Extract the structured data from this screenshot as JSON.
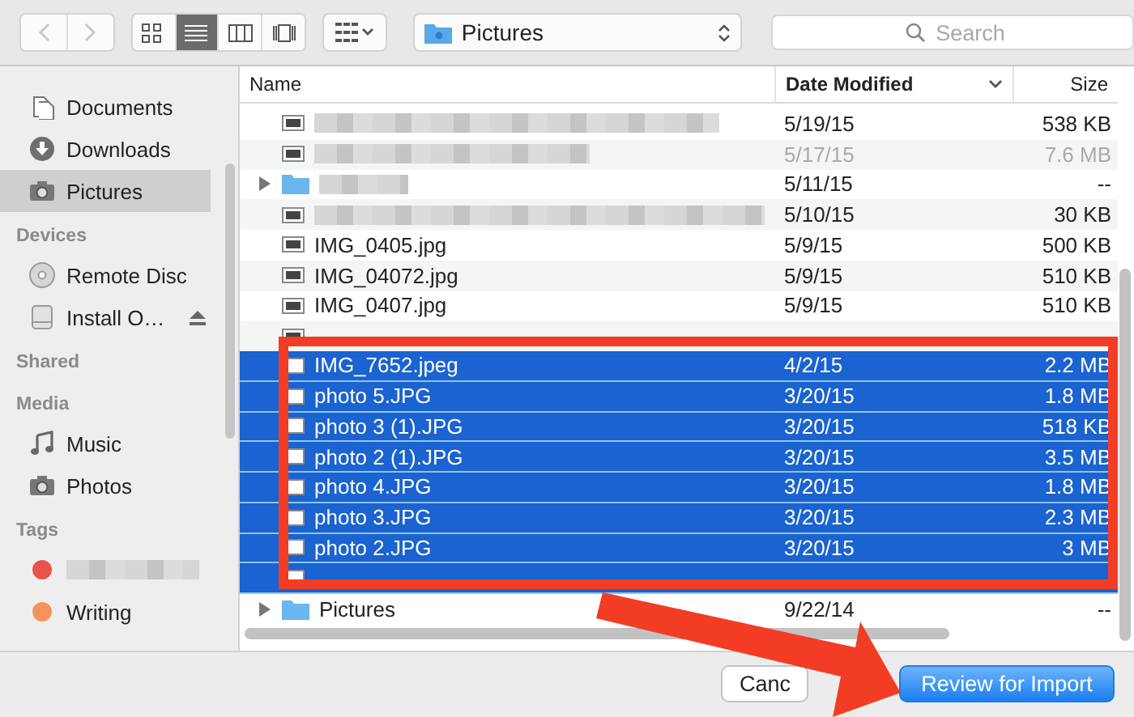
{
  "toolbar": {
    "view_modes": [
      {
        "kind": "icons",
        "selected": false
      },
      {
        "kind": "list",
        "selected": true
      },
      {
        "kind": "columns",
        "selected": false
      },
      {
        "kind": "coverflow",
        "selected": false
      }
    ],
    "location": "Pictures",
    "search": {
      "placeholder": "Search"
    }
  },
  "sidebar": [
    {
      "items": [
        {
          "label": "Documents",
          "kind": "documents",
          "selected": false
        },
        {
          "label": "Downloads",
          "kind": "downloads",
          "selected": false
        },
        {
          "label": "Pictures",
          "kind": "camera",
          "selected": true
        }
      ]
    },
    {
      "title": "Devices",
      "items": [
        {
          "label": "Remote Disc",
          "kind": "disc",
          "selected": false,
          "eject": false
        },
        {
          "label": "Install O…",
          "kind": "disk",
          "selected": false,
          "eject": true
        }
      ]
    },
    {
      "title": "Shared"
    },
    {
      "title": "Media",
      "items": [
        {
          "label": "Music",
          "kind": "music",
          "selected": false
        },
        {
          "label": "Photos",
          "kind": "camera",
          "selected": false
        }
      ]
    },
    {
      "title": "Tags",
      "items": [
        {
          "kind": "tag",
          "redacted": true,
          "color": "#e8534a",
          "selected": false
        },
        {
          "kind": "tag",
          "label": "Writing",
          "color": "#f5935a",
          "selected": false
        }
      ]
    }
  ],
  "table": {
    "columns": [
      {
        "label": "Name",
        "sorted": false
      },
      {
        "label": "Date Modified",
        "sorted": true
      },
      {
        "label": "Size",
        "sorted": false
      }
    ],
    "rows": [
      {
        "kind": "file",
        "redacted": true,
        "date": "5/19/15",
        "size": "538 KB",
        "selected": false,
        "dimmed": false
      },
      {
        "kind": "file",
        "redacted": true,
        "date": "5/17/15",
        "size": "7.6 MB",
        "selected": false,
        "dimmed": true
      },
      {
        "kind": "folder",
        "redacted": true,
        "date": "5/11/15",
        "size": "--",
        "selected": false,
        "dimmed": false
      },
      {
        "kind": "file",
        "redacted": true,
        "date": "5/10/15",
        "size": "30 KB",
        "selected": false,
        "dimmed": false
      },
      {
        "kind": "file",
        "name": "IMG_0405.jpg",
        "date": "5/9/15",
        "size": "500 KB",
        "selected": false,
        "dimmed": false
      },
      {
        "kind": "file",
        "name": "IMG_04072.jpg",
        "date": "5/9/15",
        "size": "510 KB",
        "selected": false,
        "dimmed": false
      },
      {
        "kind": "file",
        "name": "IMG_0407.jpg",
        "date": "5/9/15",
        "size": "510 KB",
        "selected": false,
        "dimmed": false
      },
      {
        "kind": "file",
        "selected": false
      },
      {
        "kind": "file",
        "name": "IMG_7652.jpeg",
        "date": "4/2/15",
        "size": "2.2 MB",
        "selected": true,
        "dimmed": false
      },
      {
        "kind": "file",
        "name": "photo 5.JPG",
        "date": "3/20/15",
        "size": "1.8 MB",
        "selected": true,
        "dimmed": false
      },
      {
        "kind": "file",
        "name": "photo 3 (1).JPG",
        "date": "3/20/15",
        "size": "518 KB",
        "selected": true,
        "dimmed": false
      },
      {
        "kind": "file",
        "name": "photo 2 (1).JPG",
        "date": "3/20/15",
        "size": "3.5 MB",
        "selected": true,
        "dimmed": false
      },
      {
        "kind": "file",
        "name": "photo 4.JPG",
        "date": "3/20/15",
        "size": "1.8 MB",
        "selected": true,
        "dimmed": false
      },
      {
        "kind": "file",
        "name": "photo 3.JPG",
        "date": "3/20/15",
        "size": "2.3 MB",
        "selected": true,
        "dimmed": false
      },
      {
        "kind": "file",
        "name": "photo 2.JPG",
        "date": "3/20/15",
        "size": "3 MB",
        "selected": true,
        "dimmed": false
      },
      {
        "kind": "file",
        "selected": true
      },
      {
        "kind": "folder",
        "name": "Pictures",
        "date": "9/22/14",
        "size": "--",
        "selected": false,
        "dimmed": false
      }
    ]
  },
  "buttons": [
    {
      "label": "Canc",
      "kind": "cancel"
    },
    {
      "label": "Review for Import",
      "kind": "default"
    }
  ],
  "annotations": {
    "highlight_box": true,
    "arrow": true
  }
}
